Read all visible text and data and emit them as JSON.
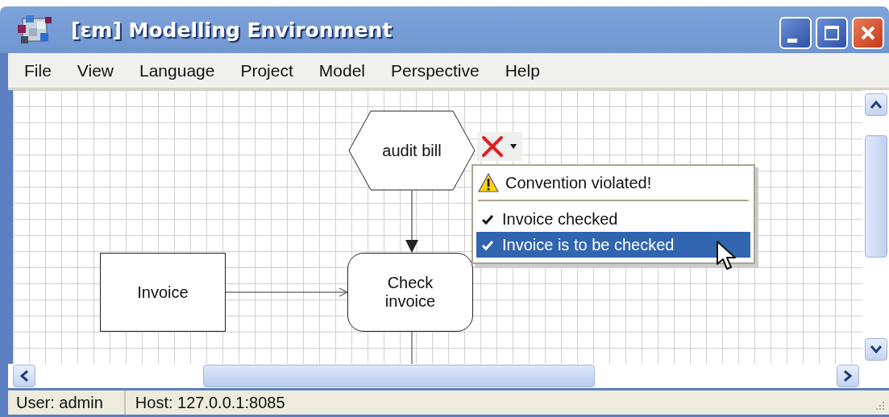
{
  "window": {
    "title": "[εm] Modelling Environment"
  },
  "menu": [
    "File",
    "View",
    "Language",
    "Project",
    "Model",
    "Perspective",
    "Help"
  ],
  "diagram": {
    "nodes": [
      {
        "kind": "event",
        "label": "audit bill"
      },
      {
        "kind": "document",
        "label": "Invoice"
      },
      {
        "kind": "function",
        "label": "Check invoice"
      }
    ]
  },
  "convention_popup": {
    "header": "Convention violated!",
    "items": [
      {
        "label": "Invoice checked",
        "checked": true,
        "selected": false
      },
      {
        "label": "Invoice is to be checked",
        "checked": true,
        "selected": true
      }
    ]
  },
  "status_bar": {
    "user": "User: admin",
    "host": "Host: 127.0.0.1:8085"
  }
}
